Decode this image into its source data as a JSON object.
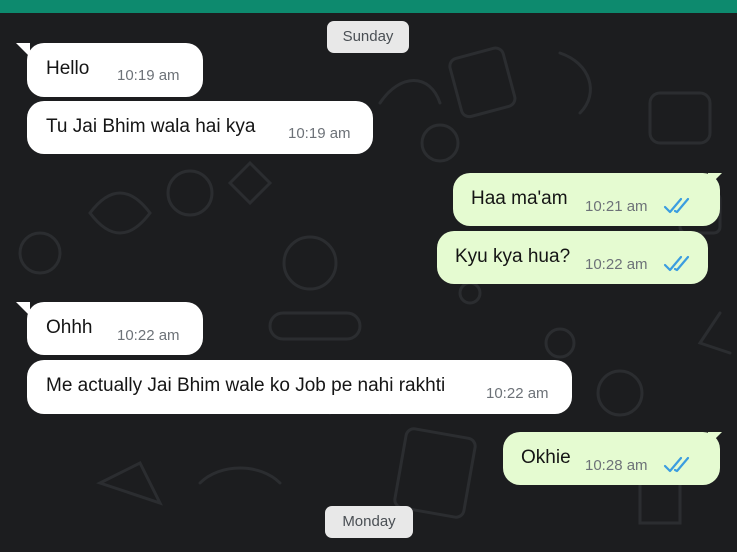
{
  "chat": {
    "date_separators": [
      "Sunday",
      "Monday"
    ],
    "messages": [
      {
        "text": "Hello",
        "time": "10:19 am",
        "direction": "incoming"
      },
      {
        "text": "Tu Jai Bhim wala hai kya",
        "time": "10:19 am",
        "direction": "incoming"
      },
      {
        "text": "Haa ma'am",
        "time": "10:21 am",
        "direction": "outgoing",
        "status": "read-double-check-icon"
      },
      {
        "text": "Kyu kya hua?",
        "time": "10:22 am",
        "direction": "outgoing",
        "status": "read-double-check-icon"
      },
      {
        "text": "Ohhh",
        "time": "10:22 am",
        "direction": "incoming"
      },
      {
        "text": "Me actually Jai Bhim wale ko Job pe nahi rakhti",
        "time": "10:22 am",
        "direction": "incoming"
      },
      {
        "text": "Okhie",
        "time": "10:28 am",
        "direction": "outgoing",
        "status": "read-double-check-icon"
      }
    ]
  },
  "colors": {
    "header_accent": "#0d8a6e",
    "wallpaper": "#1c1d1f",
    "incoming_bubble": "#ffffff",
    "outgoing_bubble": "#e5fbd1",
    "read_ticks": "#3b9de0"
  }
}
